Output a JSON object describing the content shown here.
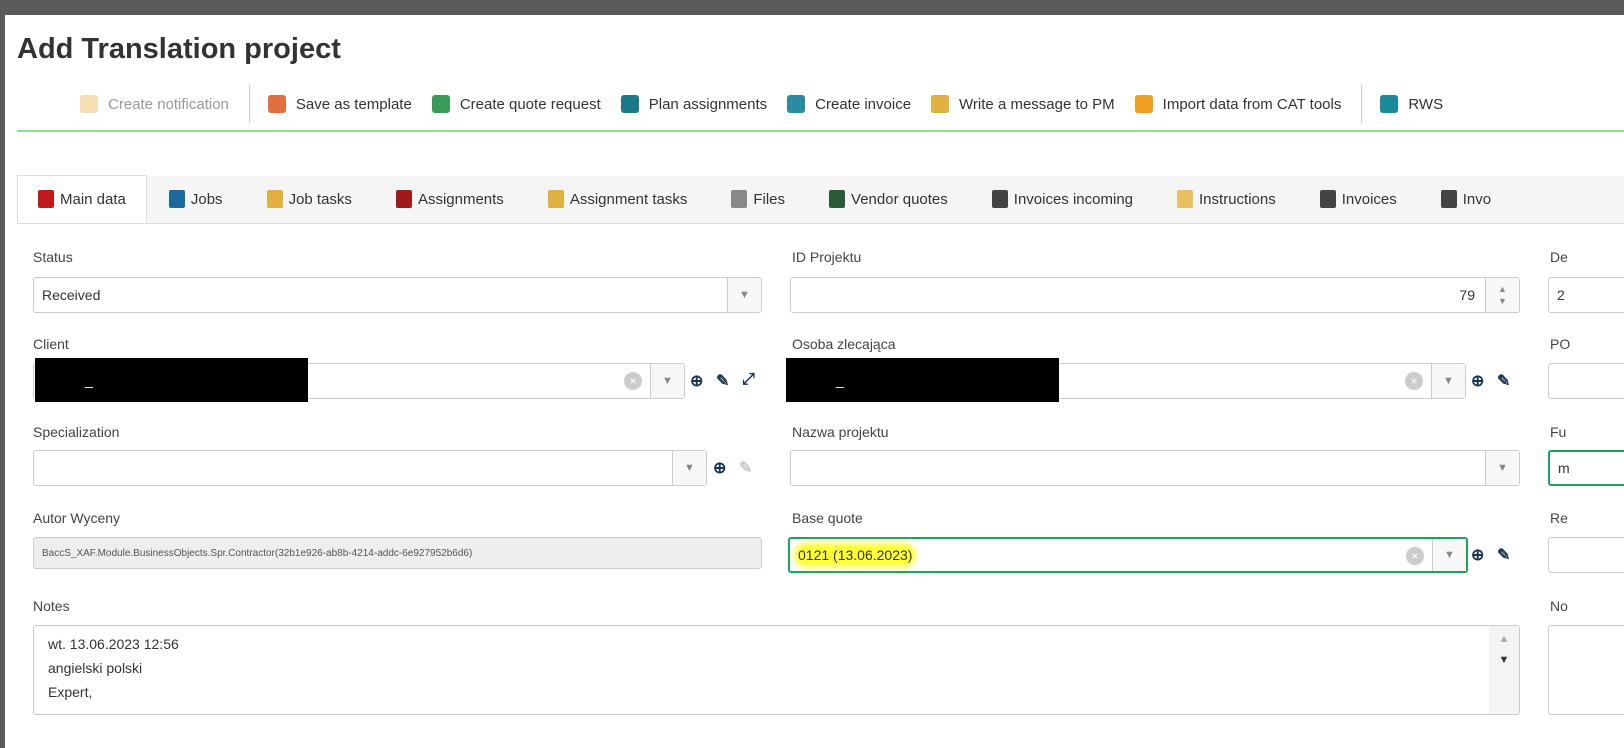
{
  "title": "Add Translation project",
  "toolbar": [
    {
      "label": "Create notification",
      "icon": "bell-icon",
      "disabled": true,
      "color": "#f5deb3"
    },
    {
      "label": "Save as template",
      "icon": "save-template-icon",
      "color": "#e07040"
    },
    {
      "label": "Create quote request",
      "icon": "cart-plus-icon",
      "color": "#3a9a5a"
    },
    {
      "label": "Plan assignments",
      "icon": "head-icon",
      "color": "#1a7a8a"
    },
    {
      "label": "Create invoice",
      "icon": "invoice-plus-icon",
      "color": "#2a8aa0"
    },
    {
      "label": "Write a message to PM",
      "icon": "envelope-icon",
      "color": "#e0b040"
    },
    {
      "label": "Import data from CAT tools",
      "icon": "import-icon",
      "color": "#f0a020"
    },
    {
      "label": "RWS",
      "icon": "rws-logo-icon",
      "color": "#1a8a9a"
    }
  ],
  "tabs": [
    {
      "label": "Main data",
      "icon": "book-icon",
      "color": "#c01a1a",
      "active": true
    },
    {
      "label": "Jobs",
      "icon": "briefcase-icon",
      "color": "#1a6aa0"
    },
    {
      "label": "Job tasks",
      "icon": "clipboard-check-icon",
      "color": "#e0b040"
    },
    {
      "label": "Assignments",
      "icon": "network-icon",
      "color": "#a01a1a"
    },
    {
      "label": "Assignment tasks",
      "icon": "clipboard-check-icon",
      "color": "#e0b040"
    },
    {
      "label": "Files",
      "icon": "paperclip-icon",
      "color": "#888"
    },
    {
      "label": "Vendor quotes",
      "icon": "cart-icon",
      "color": "#2a5a3a"
    },
    {
      "label": "Invoices incoming",
      "icon": "invoice-icon",
      "color": "#444"
    },
    {
      "label": "Instructions",
      "icon": "document-icon",
      "color": "#e8c060"
    },
    {
      "label": "Invoices",
      "icon": "invoice-dollar-icon",
      "color": "#444"
    },
    {
      "label": "Invo",
      "icon": "invoice-icon",
      "color": "#444"
    }
  ],
  "form": {
    "status": {
      "label": "Status",
      "value": "Received"
    },
    "id_projektu": {
      "label": "ID Projektu",
      "value": "79"
    },
    "col3_row1": {
      "label": "De",
      "value": "2"
    },
    "client": {
      "label": "Client",
      "value": "_"
    },
    "osoba": {
      "label": "Osoba zlecająca",
      "value": "_"
    },
    "col3_row2": {
      "label": "PO"
    },
    "specialization": {
      "label": "Specialization",
      "value": ""
    },
    "nazwa": {
      "label": "Nazwa projektu",
      "value": ""
    },
    "col3_row3": {
      "label": "Fu",
      "value": "m"
    },
    "autor": {
      "label": "Autor Wyceny",
      "value": "BaccS_XAF.Module.BusinessObjects.Spr.Contractor(32b1e926-ab8b-4214-addc-6e927952b6d6)"
    },
    "base_quote": {
      "label": "Base quote",
      "value": "0121 (13.06.2023)"
    },
    "col3_row4": {
      "label": "Re"
    },
    "notes": {
      "label": "Notes",
      "lines": [
        "wt. 13.06.2023 12:56",
        "angielski polski",
        "Expert,"
      ]
    },
    "col3_row5": {
      "label": "No"
    }
  },
  "colors": {
    "accent_green": "#1aa35a",
    "highlight": "#ffff3a",
    "separator_green": "#90e090"
  }
}
